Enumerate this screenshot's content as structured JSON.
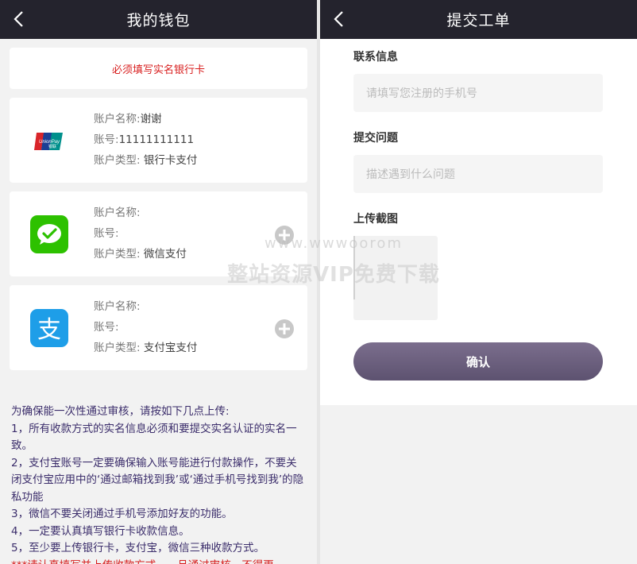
{
  "left": {
    "title": "我的钱包",
    "notice": "必须填写实名银行卡",
    "accounts": [
      {
        "icon": "unionpay-icon",
        "name_label": "账户名称:",
        "name_value": "谢谢",
        "no_label": "账号:",
        "no_value": "11111111111",
        "type_label": "账户类型:",
        "type_value": " 银行卡支付"
      },
      {
        "icon": "wechat-icon",
        "name_label": "账户名称:",
        "name_value": "",
        "no_label": "账号:",
        "no_value": "",
        "type_label": "账户类型:",
        "type_value": " 微信支付"
      },
      {
        "icon": "alipay-icon",
        "name_label": "账户名称:",
        "name_value": "",
        "no_label": "账号:",
        "no_value": "",
        "type_label": "账户类型:",
        "type_value": " 支付宝支付"
      }
    ],
    "rules": [
      "为确保能一次性通过审核，请按如下几点上传:",
      "1，所有收款方式的实名信息必须和要提交实名认证的实名一致。",
      "2，支付宝账号一定要确保输入账号能进行付款操作，不要关闭支付宝应用中的‘通过邮箱找到我’或‘通过手机号找到我’的隐私功能",
      "3，微信不要关闭通过手机号添加好友的功能。",
      "4，一定要认真填写银行卡收款信息。",
      "5，至少要上传银行卡，支付宝，微信三种收款方式。"
    ],
    "warning": "***请认真填写并上传收款方式，一旦通过审核，不得更"
  },
  "right": {
    "title": "提交工单",
    "contact_label": "联系信息",
    "contact_placeholder": "请填写您注册的手机号",
    "problem_label": "提交问题",
    "problem_placeholder": "描述遇到什么问题",
    "upload_label": "上传截图",
    "submit_label": "确认"
  },
  "watermark": {
    "line1": "www.wwwoorom",
    "line2": "整站资源VIP免费下载"
  },
  "colors": {
    "nav_bg": "#24232d",
    "notice_red": "#d81e1e",
    "rules_text": "#3b2d6b",
    "button": "#6d6180"
  }
}
